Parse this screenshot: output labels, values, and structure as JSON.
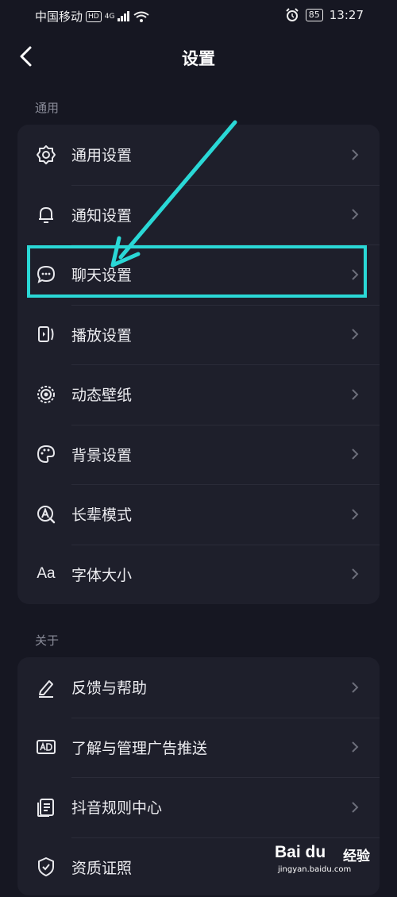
{
  "status": {
    "carrier": "中国移动",
    "hd": "HD",
    "signal": "4G",
    "battery": "85",
    "time": "13:27"
  },
  "header": {
    "title": "设置"
  },
  "sections": [
    {
      "label": "通用",
      "items": [
        {
          "label": "通用设置",
          "icon": "gear-icon"
        },
        {
          "label": "通知设置",
          "icon": "bell-icon"
        },
        {
          "label": "聊天设置",
          "icon": "chat-bubble-icon"
        },
        {
          "label": "播放设置",
          "icon": "play-settings-icon"
        },
        {
          "label": "动态壁纸",
          "icon": "live-wallpaper-icon"
        },
        {
          "label": "背景设置",
          "icon": "palette-icon"
        },
        {
          "label": "长辈模式",
          "icon": "elder-mode-icon"
        },
        {
          "label": "字体大小",
          "icon": "font-size-icon",
          "glyph": "Aa"
        }
      ]
    },
    {
      "label": "关于",
      "items": [
        {
          "label": "反馈与帮助",
          "icon": "pencil-icon"
        },
        {
          "label": "了解与管理广告推送",
          "icon": "ad-icon"
        },
        {
          "label": "抖音规则中心",
          "icon": "rules-document-icon"
        },
        {
          "label": "资质证照",
          "icon": "shield-check-icon"
        }
      ]
    }
  ],
  "annotation": {
    "color": "#2ad8d6"
  },
  "watermark": {
    "brand": "Bai du",
    "product": "经验",
    "url": "jingyan.baidu.com"
  }
}
